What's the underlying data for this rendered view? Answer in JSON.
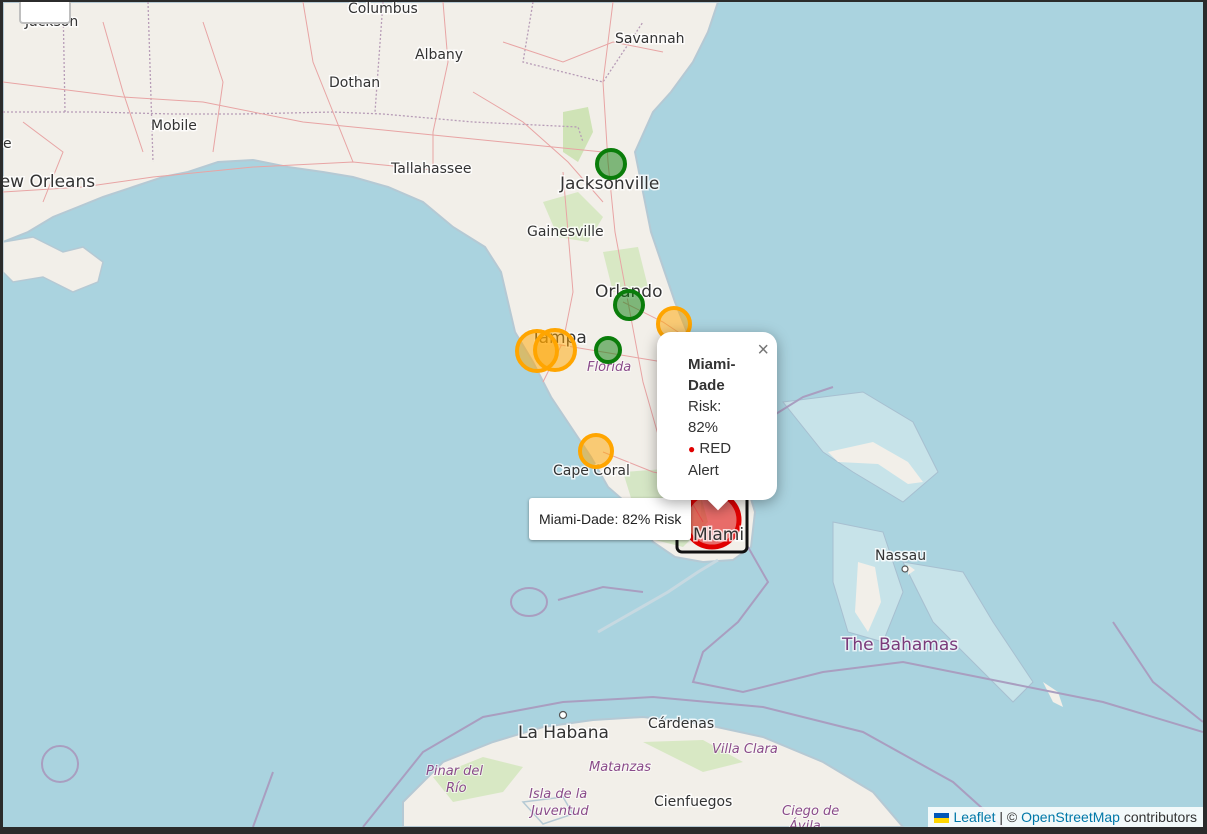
{
  "map": {
    "places": {
      "jackson": "Jackson",
      "columbus": "Columbus",
      "savannah": "Savannah",
      "albany": "Albany",
      "dothan": "Dothan",
      "mobile": "Mobile",
      "new_orleans": "New Orleans",
      "tallahassee": "Tallahassee",
      "jacksonville": "Jacksonville",
      "gainesville": "Gainesville",
      "orlando": "Orlando",
      "tampa": "Tampa",
      "florida": "Florida",
      "cape_coral": "Cape Coral",
      "miami": "Miami",
      "nassau": "Nassau",
      "bahamas": "The Bahamas",
      "la_habana": "La Habana",
      "cardenas": "Cárdenas",
      "villa_clara": "Villa Clara",
      "matanzas": "Matanzas",
      "pinar_del_rio_1": "Pinar del",
      "pinar_del_rio_2": "Río",
      "isla_juventud_1": "Isla de la",
      "isla_juventud_2": "Juventud",
      "cienfuegos": "Cienfuegos",
      "ciego_1": "Ciego de",
      "ciego_2": "Ávila",
      "e_partial": "e",
      "p_partial": "P"
    },
    "risk_colors": {
      "green": "#0a7d0a",
      "orange": "#ffa500",
      "red": "#e00000"
    }
  },
  "popup": {
    "title": "Miami-Dade",
    "risk_label": "Risk:",
    "risk_value": "82%",
    "alert_dot": "●",
    "alert_level": "RED",
    "alert_word": "Alert",
    "close_symbol": "×"
  },
  "tooltip": {
    "text": "Miami-Dade: 82% Risk"
  },
  "attribution": {
    "leaflet": "Leaflet",
    "separator": "| ©",
    "osm": "OpenStreetMap",
    "suffix": "contributors"
  }
}
